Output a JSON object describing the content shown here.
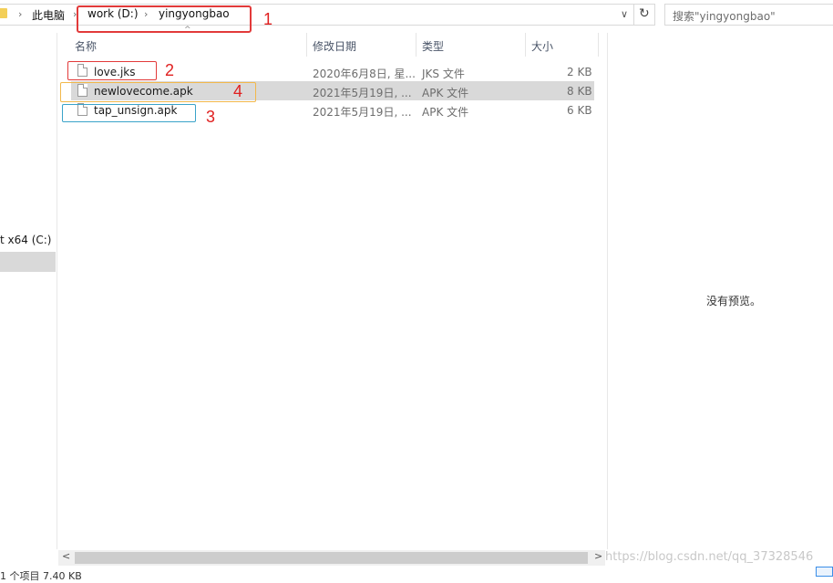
{
  "address_bar": {
    "crumbs": [
      "此电脑",
      "work (D:)",
      "yingyongbao"
    ],
    "separator": "›",
    "chevron": "∨",
    "refresh_icon": "refresh-icon"
  },
  "search": {
    "placeholder": "搜索\"yingyongbao\""
  },
  "nav": {
    "drive_label": "t x64 (C:)"
  },
  "columns": [
    "名称",
    "修改日期",
    "类型",
    "大小"
  ],
  "sort_arrow": "^",
  "files": [
    {
      "name": "love.jks",
      "date": "2020年6月8日, 星...",
      "type": "JKS 文件",
      "size": "2 KB",
      "selected": false
    },
    {
      "name": "newlovecome.apk",
      "date": "2021年5月19日, ...",
      "type": "APK 文件",
      "size": "8 KB",
      "selected": true
    },
    {
      "name": "tap_unsign.apk",
      "date": "2021年5月19日, ...",
      "type": "APK 文件",
      "size": "6 KB",
      "selected": false
    }
  ],
  "annotations": [
    "1",
    "2",
    "4",
    "3"
  ],
  "annotation_colors": {
    "red": "#e23a3a",
    "orange": "#f2b84b",
    "teal": "#3aa3c9"
  },
  "preview": {
    "message": "没有预览。"
  },
  "scrollbar": {
    "left": "<",
    "right": ">"
  },
  "watermark": "https://blog.csdn.net/qq_37328546",
  "status": "1 个项目  7.40 KB"
}
